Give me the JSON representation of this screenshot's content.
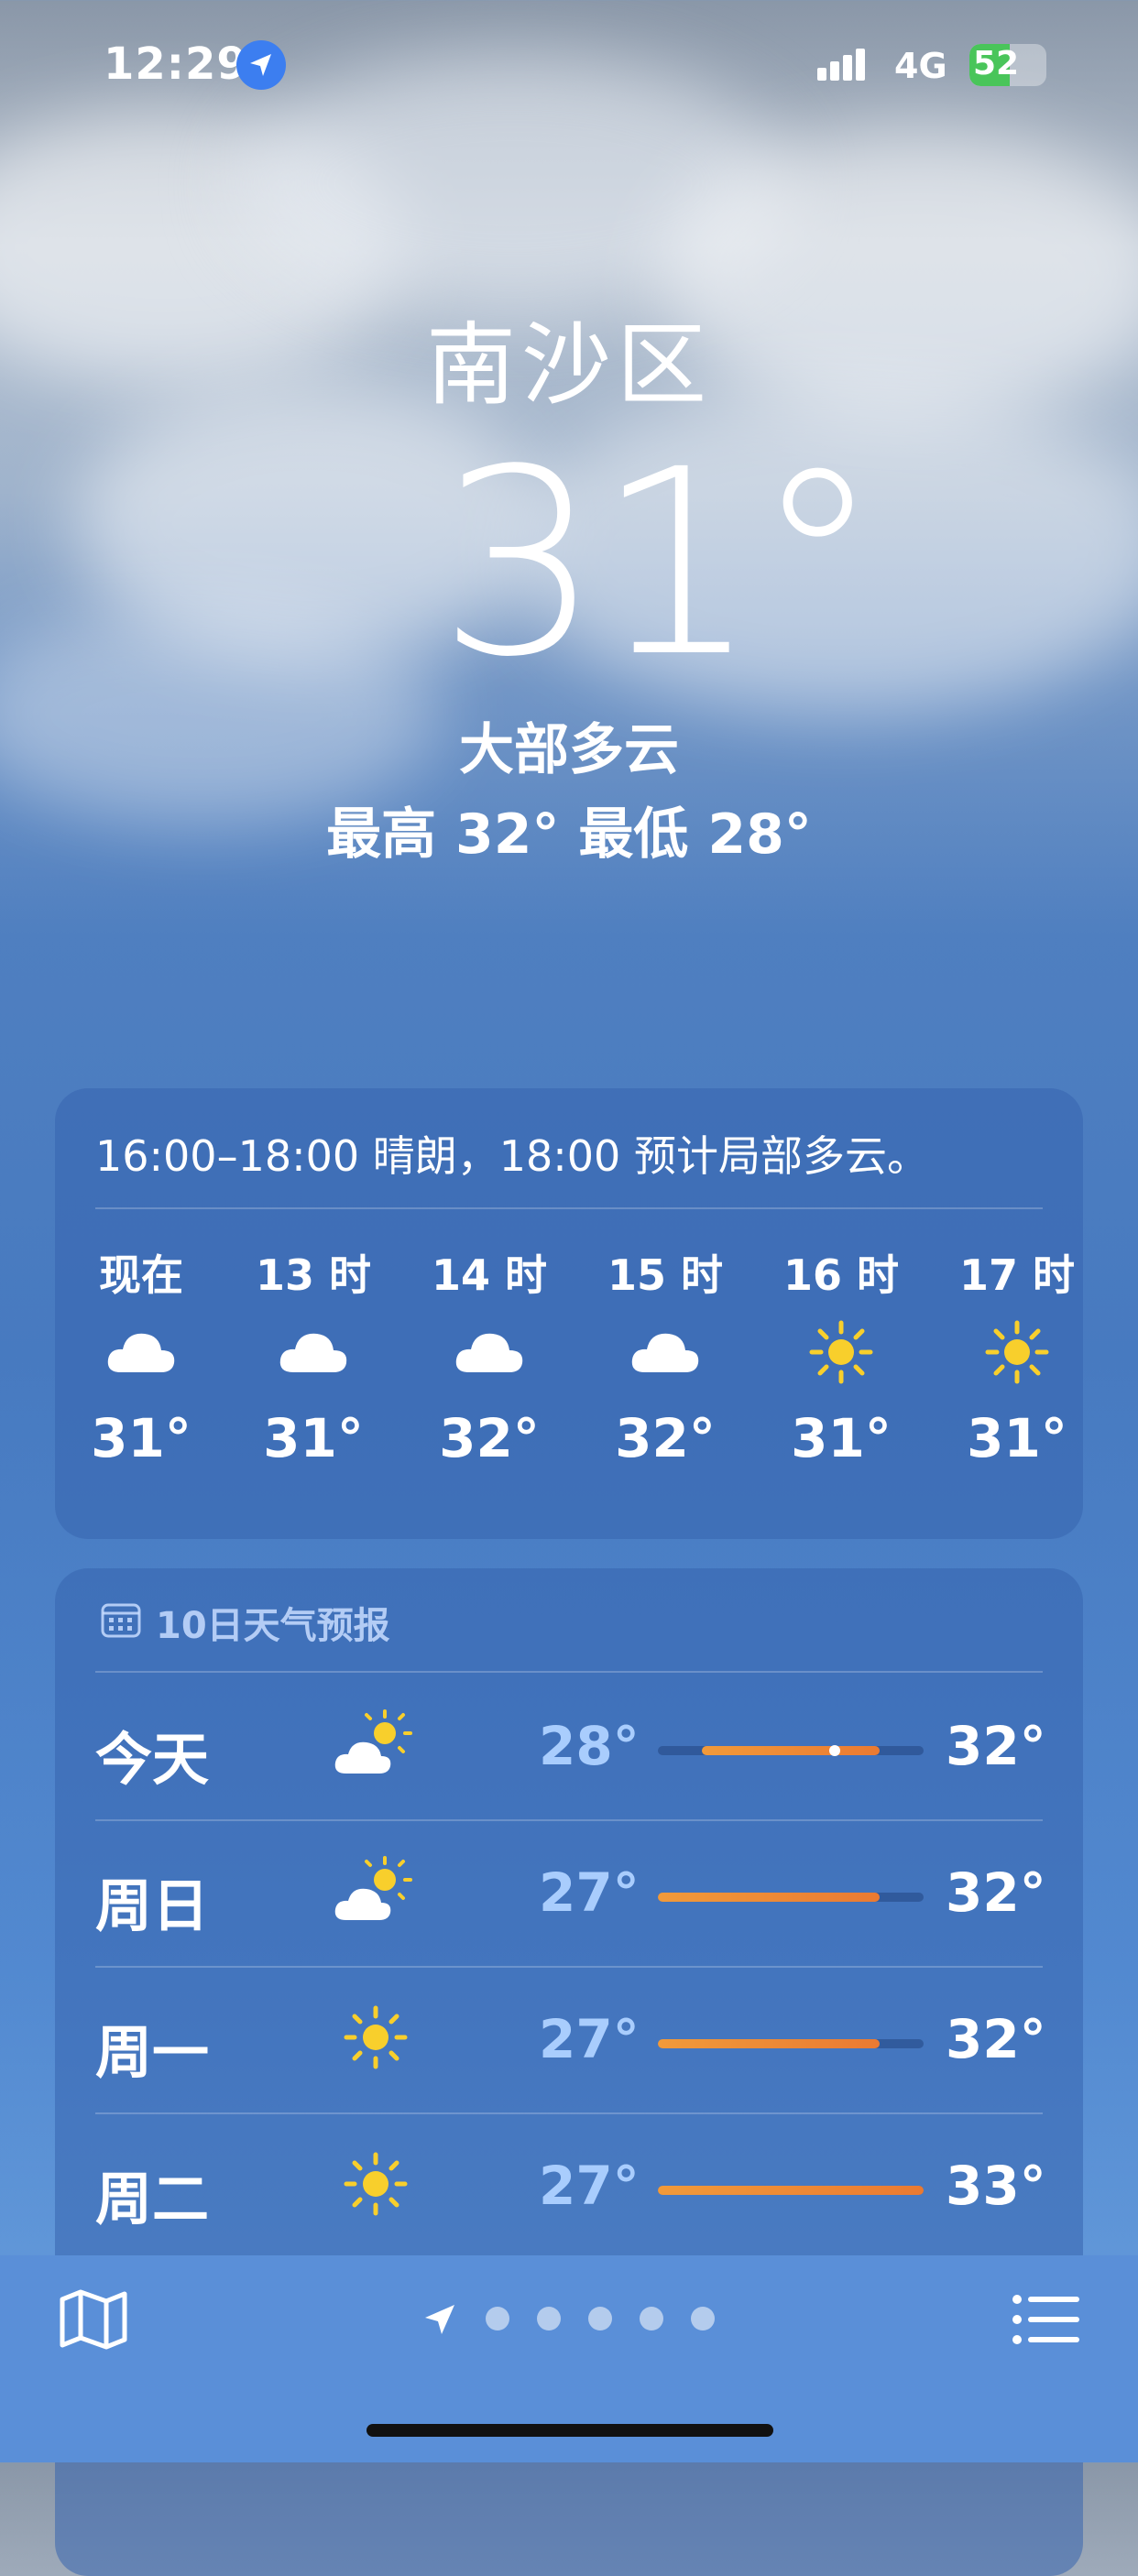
{
  "status_bar": {
    "time": "12:29",
    "network": "4G",
    "battery": "52",
    "battery_level": 0.52,
    "location_icon": "location-arrow-icon",
    "battery_color": "#49c55a"
  },
  "location": {
    "city": "南沙区",
    "temperature": "31°",
    "condition": "大部多云",
    "high_low": "最高 32°  最低 28°"
  },
  "hourly": {
    "summary": "16:00–18:00 晴朗，18:00 预计局部多云。",
    "items": [
      {
        "label": "现在",
        "icon": "cloud-icon",
        "temp": "31°"
      },
      {
        "label": "13 时",
        "icon": "cloud-icon",
        "temp": "31°"
      },
      {
        "label": "14 时",
        "icon": "cloud-icon",
        "temp": "32°"
      },
      {
        "label": "15 时",
        "icon": "cloud-icon",
        "temp": "32°"
      },
      {
        "label": "16 时",
        "icon": "sun-icon",
        "temp": "31°"
      },
      {
        "label": "17 时",
        "icon": "sun-icon",
        "temp": "31°"
      }
    ]
  },
  "daily": {
    "title": "10日天气预报",
    "range": [
      27,
      33
    ],
    "current_temp": 31,
    "rows": [
      {
        "day": "今天",
        "icon": "partly-sunny-icon",
        "low": "28°",
        "high": "32°",
        "low_value": 28,
        "high_value": 32
      },
      {
        "day": "周日",
        "icon": "partly-sunny-icon",
        "low": "27°",
        "high": "32°",
        "low_value": 27,
        "high_value": 32
      },
      {
        "day": "周一",
        "icon": "sun-icon",
        "low": "27°",
        "high": "32°",
        "low_value": 27,
        "high_value": 32
      },
      {
        "day": "周二",
        "icon": "sun-icon",
        "low": "27°",
        "high": "33°",
        "low_value": 27,
        "high_value": 33
      }
    ]
  },
  "toolbar": {
    "map_icon": "map-icon",
    "list_icon": "list-icon",
    "page_count": 5
  },
  "colors": {
    "sun": "#f8cf2c",
    "low_temp": "#a9cdfd",
    "bar": "#ea7a32"
  }
}
